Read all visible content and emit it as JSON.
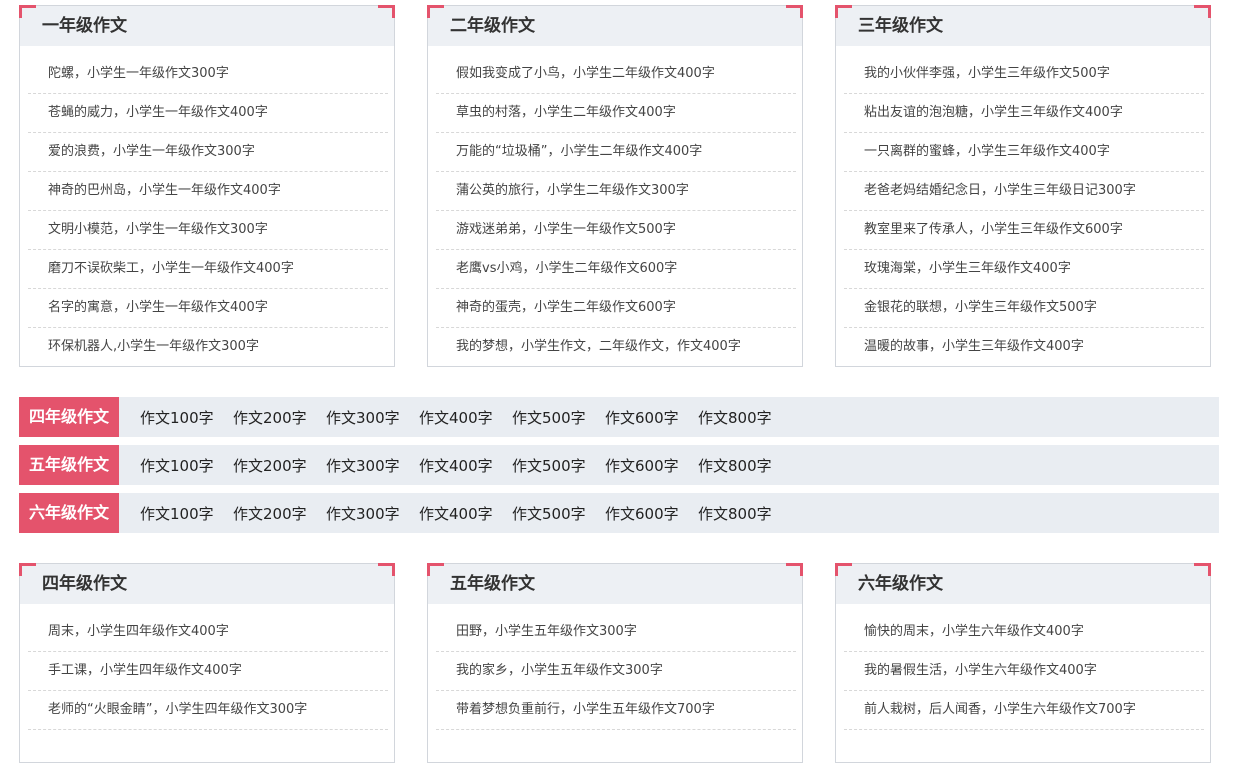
{
  "top_panels": [
    {
      "title": "一年级作文",
      "items": [
        "陀螺，小学生一年级作文300字",
        "苍蝇的威力，小学生一年级作文400字",
        "爱的浪费，小学生一年级作文300字",
        "神奇的巴州岛，小学生一年级作文400字",
        "文明小模范，小学生一年级作文300字",
        "磨刀不误砍柴工，小学生一年级作文400字",
        "名字的寓意，小学生一年级作文400字",
        "环保机器人,小学生一年级作文300字"
      ]
    },
    {
      "title": "二年级作文",
      "items": [
        "假如我变成了小鸟，小学生二年级作文400字",
        "草虫的村落，小学生二年级作文400字",
        "万能的“垃圾桶”，小学生二年级作文400字",
        "蒲公英的旅行，小学生二年级作文300字",
        "游戏迷弟弟，小学生一年级作文500字",
        "老鹰vs小鸡，小学生二年级作文600字",
        "神奇的蛋壳，小学生二年级作文600字",
        "我的梦想，小学生作文，二年级作文，作文400字"
      ]
    },
    {
      "title": "三年级作文",
      "items": [
        "我的小伙伴李强，小学生三年级作文500字",
        "粘出友谊的泡泡糖，小学生三年级作文400字",
        "一只离群的蜜蜂，小学生三年级作文400字",
        "老爸老妈结婚纪念日，小学生三年级日记300字",
        "教室里来了传承人，小学生三年级作文600字",
        "玫瑰海棠，小学生三年级作文400字",
        "金银花的联想，小学生三年级作文500字",
        "温暖的故事，小学生三年级作文400字"
      ]
    }
  ],
  "grade_bars": [
    {
      "label": "四年级作文",
      "links": [
        "作文100字",
        "作文200字",
        "作文300字",
        "作文400字",
        "作文500字",
        "作文600字",
        "作文800字"
      ]
    },
    {
      "label": "五年级作文",
      "links": [
        "作文100字",
        "作文200字",
        "作文300字",
        "作文400字",
        "作文500字",
        "作文600字",
        "作文800字"
      ]
    },
    {
      "label": "六年级作文",
      "links": [
        "作文100字",
        "作文200字",
        "作文300字",
        "作文400字",
        "作文500字",
        "作文600字",
        "作文800字"
      ]
    }
  ],
  "bottom_panels": [
    {
      "title": "四年级作文",
      "items": [
        "周末，小学生四年级作文400字",
        "手工课，小学生四年级作文400字",
        "老师的“火眼金睛”，小学生四年级作文300字"
      ]
    },
    {
      "title": "五年级作文",
      "items": [
        "田野，小学生五年级作文300字",
        "我的家乡，小学生五年级作文300字",
        "带着梦想负重前行，小学生五年级作文700字"
      ]
    },
    {
      "title": "六年级作文",
      "items": [
        "愉快的周末，小学生六年级作文400字",
        "我的暑假生活，小学生六年级作文400字",
        "前人栽树，后人闻香，小学生六年级作文700字"
      ]
    }
  ],
  "colors": {
    "accent": "#e4536c",
    "header_bg": "#edf0f4",
    "bar_bg": "#e9edf2"
  }
}
